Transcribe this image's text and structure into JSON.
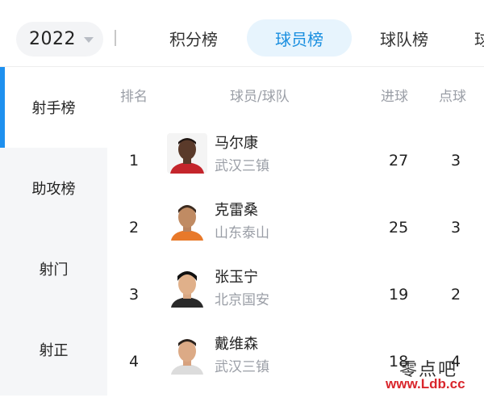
{
  "header": {
    "season": "2022",
    "tabs": [
      {
        "label": "积分榜",
        "active": false
      },
      {
        "label": "球员榜",
        "active": true
      },
      {
        "label": "球队榜",
        "active": false
      },
      {
        "label": "球",
        "active": false
      }
    ]
  },
  "sidebar": {
    "items": [
      {
        "label": "射手榜",
        "active": true
      },
      {
        "label": "助攻榜",
        "active": false
      },
      {
        "label": "射门",
        "active": false
      },
      {
        "label": "射正",
        "active": false
      }
    ]
  },
  "table": {
    "columns": {
      "rank": "排名",
      "player": "球员/球队",
      "goals": "进球",
      "penalties": "点球"
    },
    "rows": [
      {
        "rank": "1",
        "name": "马尔康",
        "team": "武汉三镇",
        "goals": "27",
        "penalties": "3"
      },
      {
        "rank": "2",
        "name": "克雷桑",
        "team": "山东泰山",
        "goals": "25",
        "penalties": "3"
      },
      {
        "rank": "3",
        "name": "张玉宁",
        "team": "北京国安",
        "goals": "19",
        "penalties": "2"
      },
      {
        "rank": "4",
        "name": "戴维森",
        "team": "武汉三镇",
        "goals": "18",
        "penalties": "4"
      }
    ]
  },
  "watermark": {
    "text": "零点吧",
    "url": "www.Ldb.cc"
  },
  "colors": {
    "accent": "#1e90ef",
    "active_tab_bg": "#e7f4fd",
    "muted_text": "#9a9ea6",
    "sidebar_bg": "#f5f6f8",
    "watermark_url": "#d9262c"
  },
  "icons": {
    "season_dropdown": "chevron-down-icon",
    "avatars": "player-avatar"
  }
}
